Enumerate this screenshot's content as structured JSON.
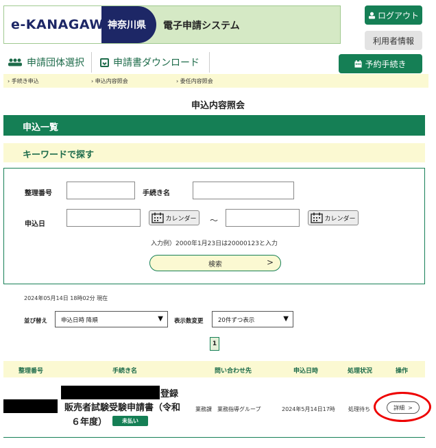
{
  "header": {
    "logo_text": "e-KANAGAWA",
    "prefecture": "神奈川県",
    "system_name": "電子申請システム",
    "logout_label": "ログアウト",
    "user_info_label": "利用者情報"
  },
  "nav": {
    "group_select": "申請団体選択",
    "download": "申請書ダウンロード",
    "reserve": "予約手続き"
  },
  "breadcrumb": [
    "手続き申込",
    "申込内容照会",
    "委任内容照会"
  ],
  "page_title": "申込内容照会",
  "list_heading": "申込一覧",
  "keyword_heading": "キーワードで探す",
  "search": {
    "number_label": "整理番号",
    "number_value": "",
    "proc_label": "手続き名",
    "proc_value": "",
    "date_label": "申込日",
    "date_from": "",
    "date_to": "",
    "calendar_label": "カレンダー",
    "tilde": "～",
    "hint": "入力例）2000年1月23日は20000123と入力",
    "search_button": "検索",
    "chevron": ">"
  },
  "timestamp": "2024年05月14日 18時02分 現在",
  "sort": {
    "sort_label": "並び替え",
    "sort_value": "申込日時 降順",
    "count_label": "表示数変更",
    "count_value": "20件ずつ表示"
  },
  "pagination": {
    "current": "1"
  },
  "table": {
    "headers": [
      "整理番号",
      "手続き名",
      "問い合わせ先",
      "申込日時",
      "処理状況",
      "操作"
    ],
    "row": {
      "title_suffix": "登録",
      "title_line2": "販売者試験受験申請書（令和",
      "title_line3": "６年度）",
      "badge": "未払い",
      "contact": "業務課　業務指導グループ",
      "date": "2024年5月14日17時",
      "status": "処理待ち",
      "detail_button": "詳細",
      "detail_chevron": ">"
    }
  },
  "colors": {
    "brand_green": "#157f55",
    "navy": "#1d2766",
    "cream": "#fbf9d2",
    "highlight_red": "#e00000"
  }
}
